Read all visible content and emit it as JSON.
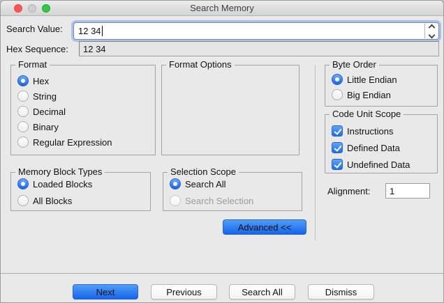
{
  "window": {
    "title": "Search Memory"
  },
  "search": {
    "label": "Search Value:",
    "value": "12 34"
  },
  "hex_sequence": {
    "label": "Hex Sequence:",
    "value": "12 34"
  },
  "format": {
    "title": "Format",
    "options": [
      {
        "label": "Hex",
        "selected": true
      },
      {
        "label": "String",
        "selected": false
      },
      {
        "label": "Decimal",
        "selected": false
      },
      {
        "label": "Binary",
        "selected": false
      },
      {
        "label": "Regular Expression",
        "selected": false
      }
    ]
  },
  "format_options": {
    "title": "Format Options"
  },
  "byte_order": {
    "title": "Byte Order",
    "options": [
      {
        "label": "Little Endian",
        "selected": true
      },
      {
        "label": "Big Endian",
        "selected": false
      }
    ]
  },
  "code_unit_scope": {
    "title": "Code Unit Scope",
    "options": [
      {
        "label": "Instructions",
        "checked": true
      },
      {
        "label": "Defined Data",
        "checked": true
      },
      {
        "label": "Undefined Data",
        "checked": true
      }
    ]
  },
  "memory_block_types": {
    "title": "Memory Block Types",
    "options": [
      {
        "label": "Loaded Blocks",
        "selected": true
      },
      {
        "label": "All Blocks",
        "selected": false
      }
    ]
  },
  "selection_scope": {
    "title": "Selection Scope",
    "options": [
      {
        "label": "Search All",
        "selected": true
      },
      {
        "label": "Search Selection",
        "selected": false,
        "disabled": true
      }
    ]
  },
  "alignment": {
    "label": "Alignment:",
    "value": "1"
  },
  "advanced_button": {
    "label": "Advanced <<"
  },
  "footer": {
    "buttons": [
      {
        "label": "Next",
        "primary": true
      },
      {
        "label": "Previous",
        "primary": false
      },
      {
        "label": "Search All",
        "primary": false
      },
      {
        "label": "Dismiss",
        "primary": false
      }
    ]
  },
  "colors": {
    "accent_blue": "#1b6cf0",
    "dialog_background": "#e9e9e9",
    "traffic_red": "#fc5753",
    "traffic_gray": "#cdcdcd",
    "traffic_green": "#33c748"
  }
}
